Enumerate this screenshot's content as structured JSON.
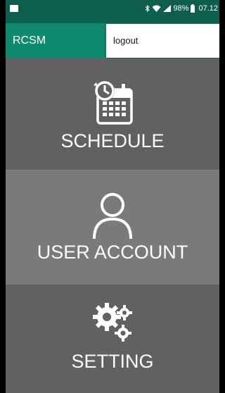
{
  "status_bar": {
    "battery": "98%",
    "time": "07.12"
  },
  "app_bar": {
    "title": "RCSM"
  },
  "menu": {
    "items": [
      {
        "label": "logout"
      }
    ]
  },
  "tiles": [
    {
      "label": "SCHEDULE",
      "icon": "calendar-clock-icon"
    },
    {
      "label": "USER ACCOUNT",
      "icon": "user-icon"
    },
    {
      "label": "SETTING",
      "icon": "gears-icon"
    }
  ],
  "colors": {
    "status_bar": "#0e5e4d",
    "app_bar": "#0f8a6e",
    "tile_dark": "#616161",
    "tile_light": "#7a7a7a",
    "text": "#ffffff"
  }
}
